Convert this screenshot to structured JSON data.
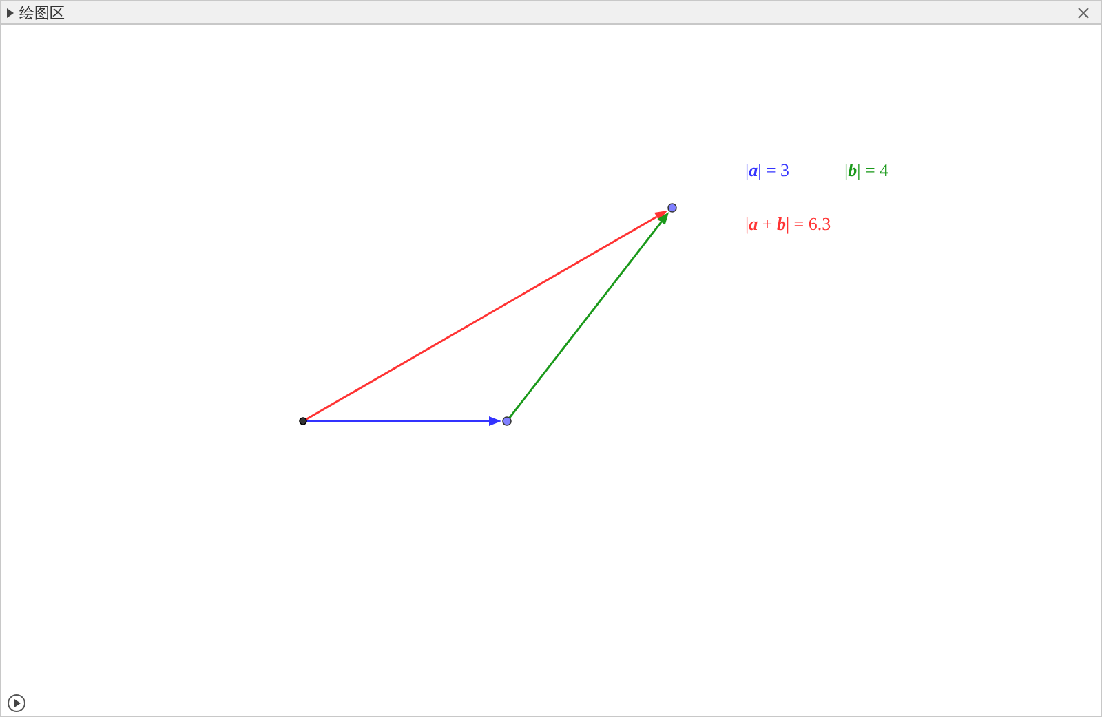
{
  "panel": {
    "title": "绘图区"
  },
  "vectors": [
    {
      "color": "#ff3333"
    },
    {
      "color": "#3333ff"
    },
    {
      "color": "#1a991a"
    }
  ],
  "labels": [
    {
      "text": "|**a**| = 3",
      "color": "#3333ff"
    },
    {
      "text": "|**b**| = 4",
      "color": "#1a991a"
    },
    {
      "text": "|**a** + **b**| = 6.3",
      "color": "#ff3333"
    }
  ]
}
